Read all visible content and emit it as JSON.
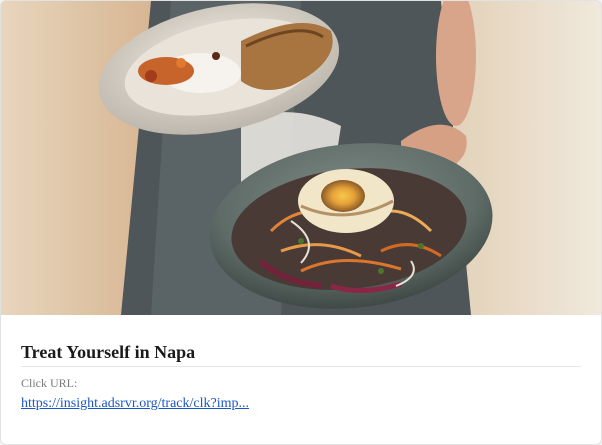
{
  "card": {
    "image_alt": "Server holding two bowls of food",
    "title": "Treat Yourself in Napa",
    "click_label": "Click URL:",
    "click_url_text": "https://insight.adsrvr.org/track/clk?imp..."
  },
  "colors": {
    "link": "#1a56c8",
    "title": "#1a1a1a",
    "label": "#7a7a7a"
  }
}
